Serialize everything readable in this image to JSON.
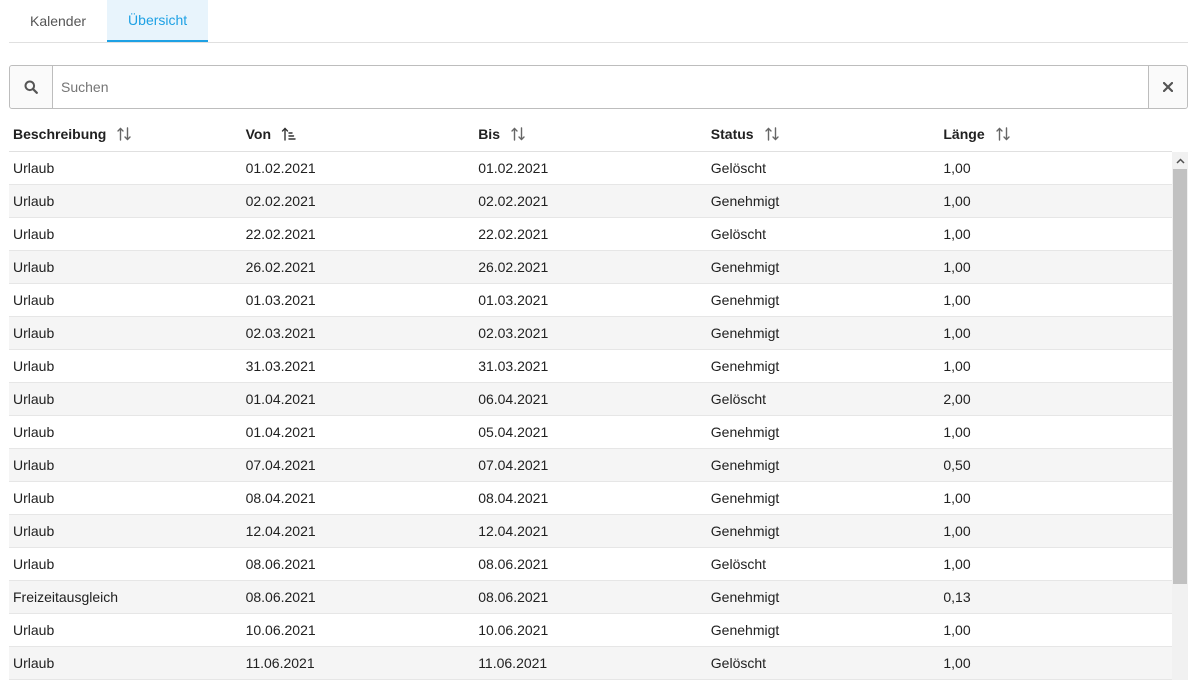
{
  "tabs": [
    {
      "label": "Kalender"
    },
    {
      "label": "Übersicht"
    }
  ],
  "search": {
    "placeholder": "Suchen",
    "value": ""
  },
  "columns": [
    {
      "label": "Beschreibung"
    },
    {
      "label": "Von"
    },
    {
      "label": "Bis"
    },
    {
      "label": "Status"
    },
    {
      "label": "Länge"
    }
  ],
  "rows": [
    [
      "Urlaub",
      "01.02.2021",
      "01.02.2021",
      "Gelöscht",
      "1,00"
    ],
    [
      "Urlaub",
      "02.02.2021",
      "02.02.2021",
      "Genehmigt",
      "1,00"
    ],
    [
      "Urlaub",
      "22.02.2021",
      "22.02.2021",
      "Gelöscht",
      "1,00"
    ],
    [
      "Urlaub",
      "26.02.2021",
      "26.02.2021",
      "Genehmigt",
      "1,00"
    ],
    [
      "Urlaub",
      "01.03.2021",
      "01.03.2021",
      "Genehmigt",
      "1,00"
    ],
    [
      "Urlaub",
      "02.03.2021",
      "02.03.2021",
      "Genehmigt",
      "1,00"
    ],
    [
      "Urlaub",
      "31.03.2021",
      "31.03.2021",
      "Genehmigt",
      "1,00"
    ],
    [
      "Urlaub",
      "01.04.2021",
      "06.04.2021",
      "Gelöscht",
      "2,00"
    ],
    [
      "Urlaub",
      "01.04.2021",
      "05.04.2021",
      "Genehmigt",
      "1,00"
    ],
    [
      "Urlaub",
      "07.04.2021",
      "07.04.2021",
      "Genehmigt",
      "0,50"
    ],
    [
      "Urlaub",
      "08.04.2021",
      "08.04.2021",
      "Genehmigt",
      "1,00"
    ],
    [
      "Urlaub",
      "12.04.2021",
      "12.04.2021",
      "Genehmigt",
      "1,00"
    ],
    [
      "Urlaub",
      "08.06.2021",
      "08.06.2021",
      "Gelöscht",
      "1,00"
    ],
    [
      "Freizeitausgleich",
      "08.06.2021",
      "08.06.2021",
      "Genehmigt",
      "0,13"
    ],
    [
      "Urlaub",
      "10.06.2021",
      "10.06.2021",
      "Genehmigt",
      "1,00"
    ],
    [
      "Urlaub",
      "11.06.2021",
      "11.06.2021",
      "Gelöscht",
      "1,00"
    ]
  ],
  "colors": {
    "accent": "#1ea1e4",
    "tab_active_bg": "#e8f4fc",
    "row_alt": "#f5f5f5"
  }
}
